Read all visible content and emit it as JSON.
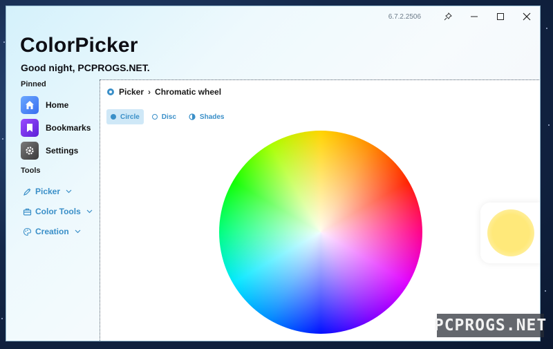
{
  "app": {
    "title": "ColorPicker",
    "greeting": "Good night, PCPROGS.NET.",
    "version": "6.7.2.2506"
  },
  "sidebar": {
    "pinned_label": "Pinned",
    "pinned": [
      {
        "label": "Home",
        "icon": "home-icon",
        "color": "#4a8cff"
      },
      {
        "label": "Bookmarks",
        "icon": "bookmark-icon",
        "color": "#7b2ff7"
      },
      {
        "label": "Settings",
        "icon": "gear-icon",
        "color": "#5a5a5a"
      }
    ],
    "tools_label": "Tools",
    "tools": [
      {
        "label": "Picker",
        "icon": "eyedropper-icon"
      },
      {
        "label": "Color Tools",
        "icon": "toolbox-icon"
      },
      {
        "label": "Creation",
        "icon": "palette-icon"
      }
    ]
  },
  "main": {
    "breadcrumb": {
      "parent": "Picker",
      "separator": "›",
      "current": "Chromatic wheel"
    },
    "tabs": [
      {
        "label": "Circle",
        "active": true
      },
      {
        "label": "Disc",
        "active": false
      },
      {
        "label": "Shades",
        "active": false
      }
    ],
    "selected_color": "#ffe97a"
  },
  "watermark": "PCPROGS.NET",
  "accent_color": "#3a8fc8"
}
